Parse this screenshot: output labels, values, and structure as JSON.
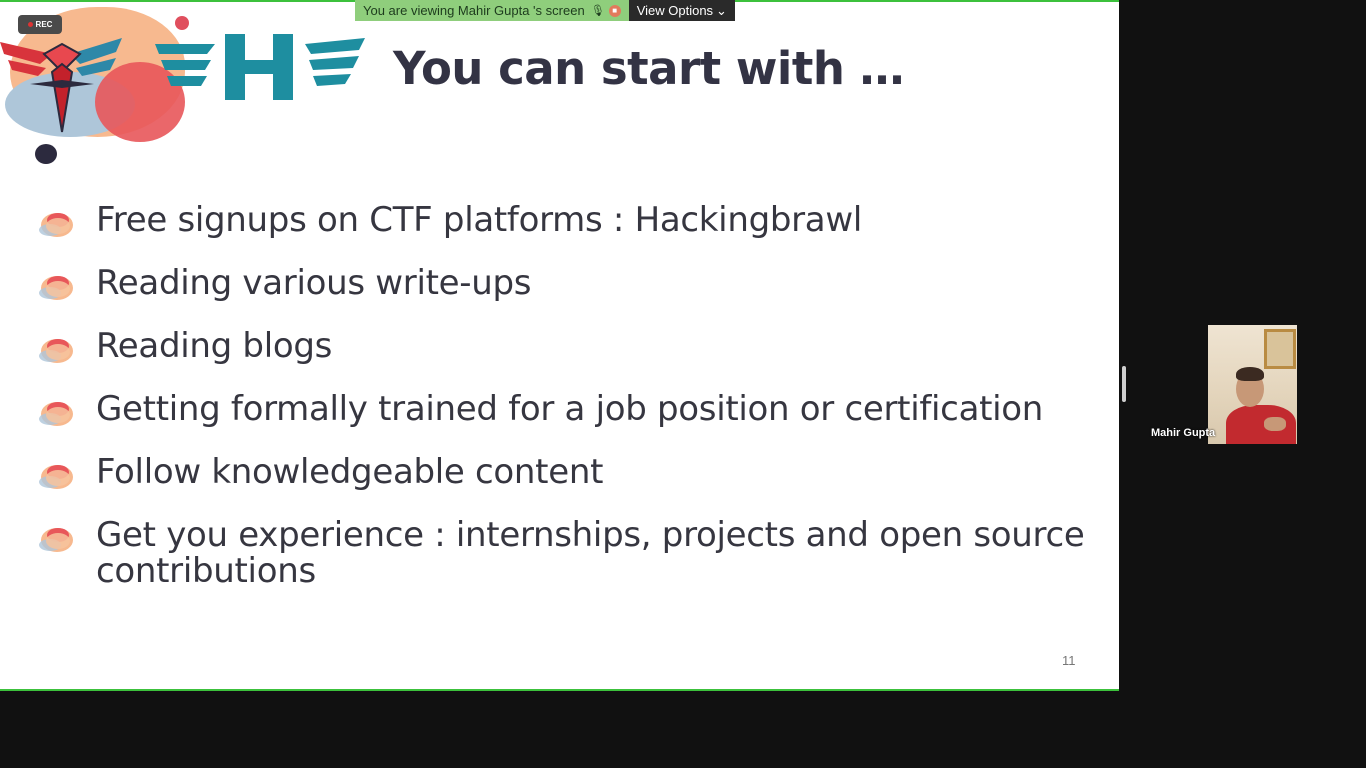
{
  "banner": {
    "viewing_text": "You are viewing Mahir Gupta 's screen",
    "view_options_label": "View Options",
    "mic_icon": "mic-muted-icon",
    "stop_icon": "stop-icon"
  },
  "recording": {
    "label": "REC"
  },
  "slide": {
    "title": "You can start with …",
    "bullets": [
      "Free signups on CTF platforms : Hackingbrawl",
      "Reading various write-ups",
      "Reading blogs",
      "Getting formally trained for a job position or certification",
      "Follow knowledgeable content",
      "Get you experience : internships, projects and open source contributions"
    ],
    "page_number": "11"
  },
  "participant": {
    "name": "Mahir Gupta"
  },
  "colors": {
    "accent_green": "#3cc13c",
    "banner_green": "#8fce7c",
    "title": "#333344",
    "bullet_text": "#363640"
  }
}
